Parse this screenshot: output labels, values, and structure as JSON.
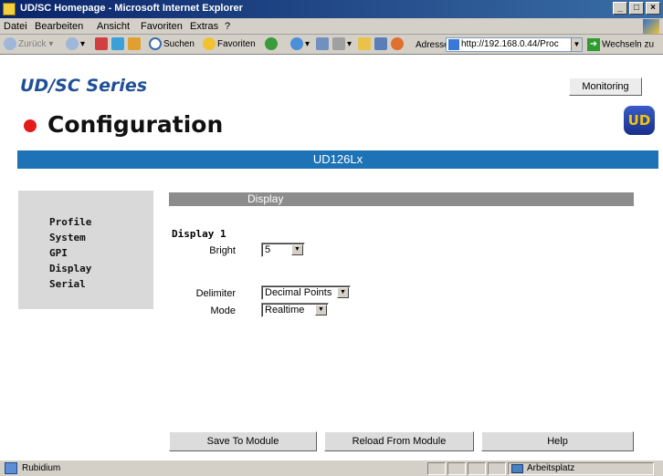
{
  "window": {
    "title": "UD/SC Homepage - Microsoft Internet Explorer",
    "min": "_",
    "max": "□",
    "close": "×"
  },
  "menu": [
    "Datei",
    "Bearbeiten",
    "Ansicht",
    "Favoriten",
    "Extras",
    "?"
  ],
  "toolbar": {
    "back": "Zurück",
    "search": "Suchen",
    "favorites": "Favoriten",
    "address_label": "Adresse",
    "address": "http://192.168.0.44/Proc",
    "go": "Wechseln zu"
  },
  "header": {
    "series": "UD/SC Series",
    "monitoring": "Monitoring",
    "title": "Configuration",
    "logo": "UD",
    "device": "UD126Lx"
  },
  "sidebar": {
    "items": [
      "Profile",
      "System",
      "GPI",
      "Display",
      "Serial"
    ]
  },
  "panel": {
    "section": "Display",
    "heading": "Display 1",
    "bright_label": "Bright",
    "bright_value": "5",
    "delimiter_label": "Delimiter",
    "delimiter_value": "Decimal Points",
    "mode_label": "Mode",
    "mode_value": "Realtime"
  },
  "buttons": {
    "save": "Save To Module",
    "reload": "Reload From Module",
    "help": "Help"
  },
  "status": {
    "left": "Rubidium",
    "zone": "Arbeitsplatz"
  },
  "colors": {
    "device_bar": "#1d73b6",
    "series_text": "#1f4f96",
    "status_dot": "#e31b1b",
    "section_bar": "#8c8c8c"
  }
}
